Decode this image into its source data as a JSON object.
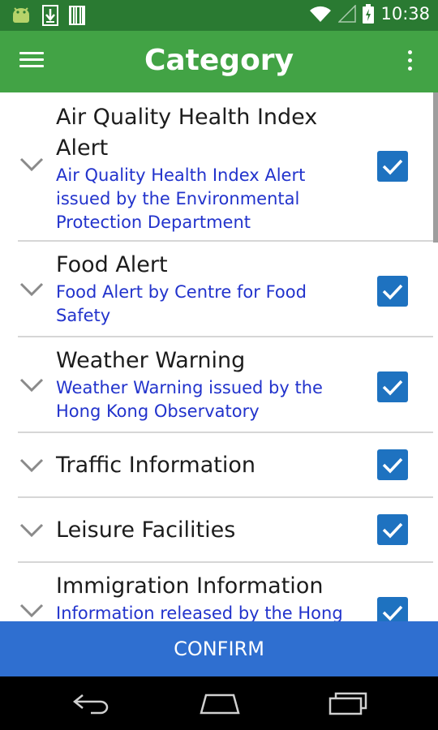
{
  "status_bar": {
    "time": "10:38",
    "icons": [
      "android-icon",
      "download-icon",
      "barcode-icon",
      "wifi-icon",
      "signal-icon",
      "battery-charging-icon"
    ]
  },
  "app_bar": {
    "title": "Category",
    "left_icon": "menu-icon",
    "right_icon": "overflow-menu-icon",
    "color": "#42a345"
  },
  "categories": [
    {
      "title": "Air Quality Health Index Alert",
      "subtitle": "Air Quality Health Index Alert issued by the Environmental Protection Department",
      "checked": true
    },
    {
      "title": "Food Alert",
      "subtitle": "Food Alert by Centre for Food Safety",
      "checked": true
    },
    {
      "title": "Weather Warning",
      "subtitle": "Weather Warning issued by the Hong Kong Observatory",
      "checked": true
    },
    {
      "title": "Traffic Information",
      "subtitle": "",
      "checked": true
    },
    {
      "title": "Leisure Facilities",
      "subtitle": "",
      "checked": true
    },
    {
      "title": "Immigration Information",
      "subtitle": "Information released by the Hong",
      "checked": true
    }
  ],
  "confirm_label": "CONFIRM",
  "colors": {
    "status_bar": "#2a7a32",
    "subtitle_text": "#2233cc",
    "checkbox": "#1e72c0",
    "confirm_button": "#2f6fd0"
  },
  "nav_bar": {
    "icons": [
      "back-icon",
      "home-icon",
      "recents-icon"
    ]
  }
}
